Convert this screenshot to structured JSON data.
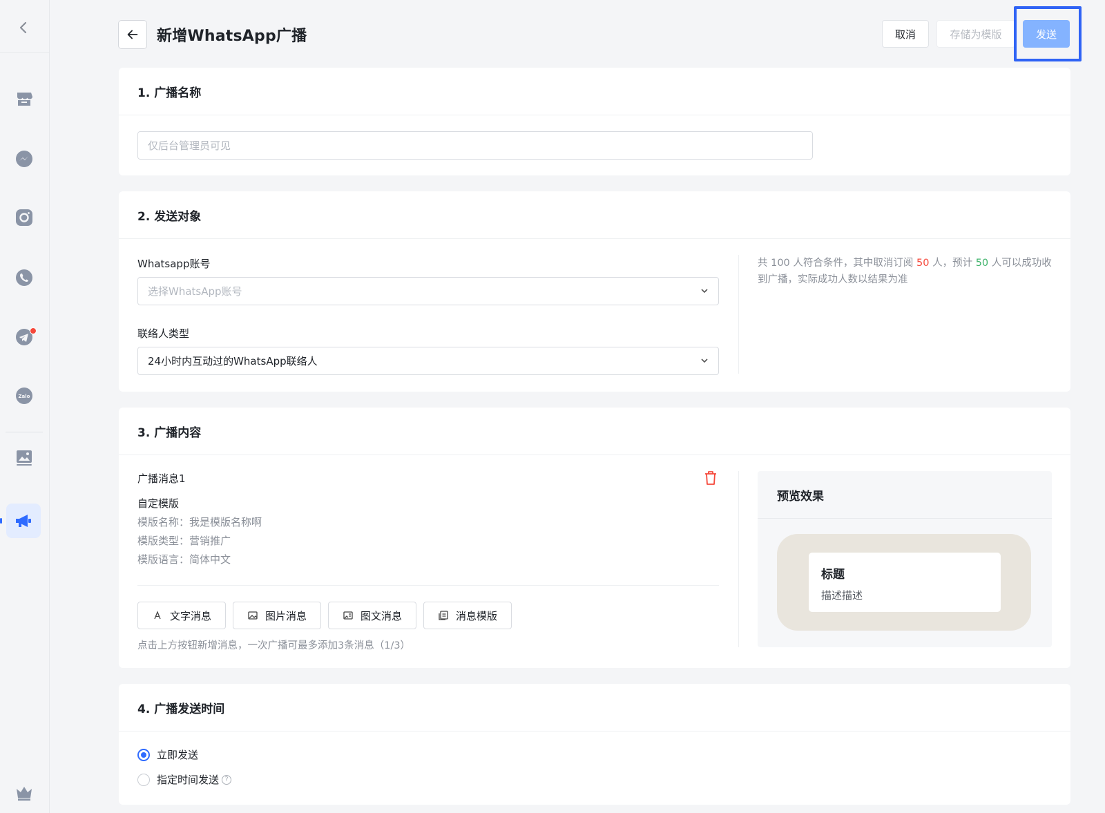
{
  "header": {
    "title": "新增WhatsApp广播",
    "cancel_label": "取消",
    "save_template_label": "存储为模版",
    "send_label": "发送"
  },
  "sidebar": {
    "items": [
      {
        "icon": "store-icon"
      },
      {
        "icon": "messenger-icon"
      },
      {
        "icon": "instagram-icon"
      },
      {
        "icon": "whatsapp-icon"
      },
      {
        "icon": "telegram-icon"
      },
      {
        "icon": "zalo-icon",
        "label": "Zalo"
      },
      {
        "icon": "gallery-icon"
      },
      {
        "icon": "megaphone-icon",
        "active": true
      },
      {
        "icon": "crown-icon"
      }
    ]
  },
  "section1": {
    "title": "1. 广播名称",
    "name_placeholder": "仅后台管理员可见"
  },
  "section2": {
    "title": "2. 发送对象",
    "account_label": "Whatsapp账号",
    "account_placeholder": "选择WhatsApp账号",
    "contact_type_label": "联络人类型",
    "contact_type_value": "24小时内互动过的WhatsApp联络人",
    "stats": {
      "prefix": "共 100 人符合条件，其中取消订阅 ",
      "unsubscribed": "50",
      "middle": " 人，预计 ",
      "reachable": "50",
      "suffix": " 人可以成功收到广播，实际成功人数以结果为准"
    }
  },
  "section3": {
    "title": "3. 广播内容",
    "message_title": "广播消息1",
    "template_kind": "自定模版",
    "template_name": "模版名称：我是模版名称啊",
    "template_type": "模版类型：营销推广",
    "template_lang": "模版语言：简体中文",
    "buttons": [
      {
        "label": "文字消息",
        "icon": "text-icon"
      },
      {
        "label": "图片消息",
        "icon": "image-icon"
      },
      {
        "label": "图文消息",
        "icon": "image-text-icon"
      },
      {
        "label": "消息模版",
        "icon": "template-icon"
      }
    ],
    "hint": "点击上方按钮新增消息，一次广播可最多添加3条消息（1/3）",
    "preview": {
      "title": "预览效果",
      "bubble_title": "标题",
      "bubble_desc": "描述描述"
    }
  },
  "section4": {
    "title": "4. 广播发送时间",
    "options": [
      {
        "label": "立即发送",
        "checked": true
      },
      {
        "label": "指定时间发送",
        "checked": false
      }
    ],
    "help_glyph": "?"
  },
  "colors": {
    "accent": "#2f6bff",
    "send_button": "#84b3ff",
    "danger": "#f5483b",
    "success": "#3fb36b"
  }
}
